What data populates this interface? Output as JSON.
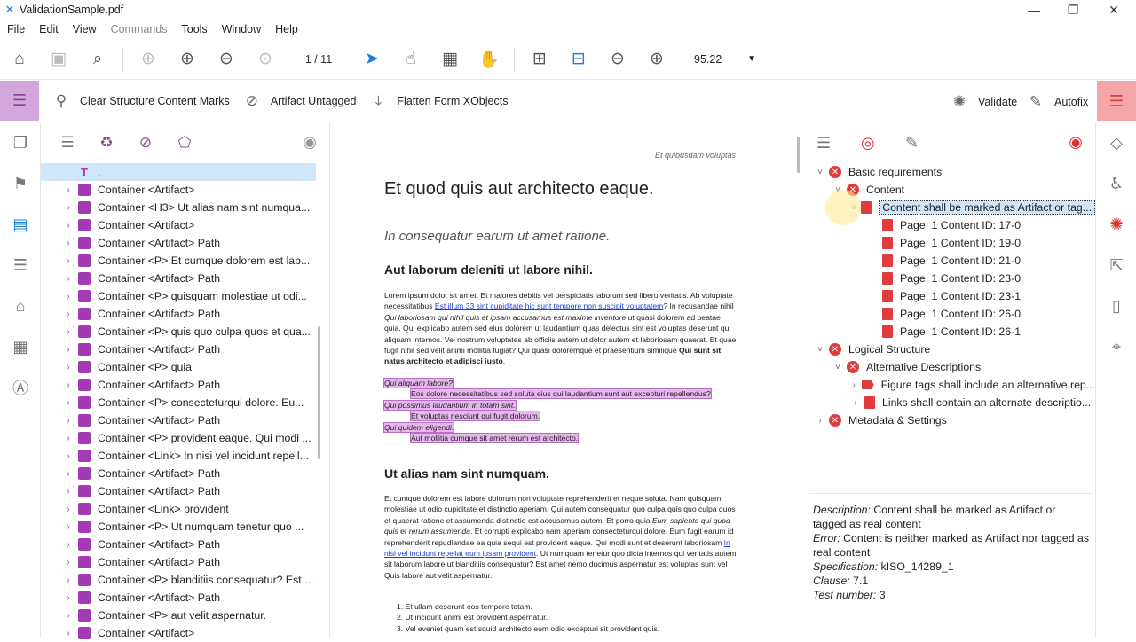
{
  "window": {
    "title": "ValidationSample.pdf",
    "controls": {
      "minimize": "—",
      "restore": "❐",
      "close": "✕"
    }
  },
  "menu": [
    "File",
    "Edit",
    "View",
    "Commands",
    "Tools",
    "Window",
    "Help"
  ],
  "toolbar": {
    "page_indicator": "1 / 11",
    "zoom_value": "95.22",
    "icons": [
      "home-icon",
      "save-icon",
      "search-icon",
      "up-icon",
      "down-icon",
      "back-icon",
      "forward-icon",
      "select-icon",
      "touch-icon",
      "grid-icon",
      "hand-icon",
      "fit-page-icon",
      "fit-width-icon",
      "zoom-out-icon",
      "zoom-in-icon"
    ]
  },
  "subtoolbar": {
    "clear_label": "Clear Structure Content Marks",
    "artifact_label": "Artifact Untagged",
    "flatten_label": "Flatten Form XObjects",
    "validate_label": "Validate",
    "autofix_label": "Autofix"
  },
  "structure_tree": [
    {
      "label": ".",
      "type": "text",
      "selected": true
    },
    {
      "label": "Container <Artifact>"
    },
    {
      "label": "Container <H3> Ut alias nam sint numqua..."
    },
    {
      "label": "Container <Artifact>"
    },
    {
      "label": "Container <Artifact> Path"
    },
    {
      "label": "Container <P> Et cumque dolorem est lab..."
    },
    {
      "label": "Container <Artifact> Path"
    },
    {
      "label": "Container <P> quisquam molestiae ut odi..."
    },
    {
      "label": "Container <Artifact> Path"
    },
    {
      "label": "Container <P> quis quo culpa quos et qua..."
    },
    {
      "label": "Container <Artifact> Path"
    },
    {
      "label": "Container <P> quia"
    },
    {
      "label": "Container <Artifact> Path"
    },
    {
      "label": "Container <P> consecteturqui dolore. Eu..."
    },
    {
      "label": "Container <Artifact> Path"
    },
    {
      "label": "Container <P> provident eaque. Qui modi ..."
    },
    {
      "label": "Container <Link> In nisi vel incidunt repell..."
    },
    {
      "label": "Container <Artifact> Path"
    },
    {
      "label": "Container <Artifact> Path"
    },
    {
      "label": "Container <Link> provident"
    },
    {
      "label": "Container <P> Ut numquam tenetur quo ..."
    },
    {
      "label": "Container <Artifact> Path"
    },
    {
      "label": "Container <Artifact> Path"
    },
    {
      "label": "Container <P> blanditiis consequatur? Est ..."
    },
    {
      "label": "Container <Artifact> Path"
    },
    {
      "label": "Container <P> aut velit aspernatur."
    },
    {
      "label": "Container <Artifact>"
    }
  ],
  "document": {
    "header": "Et quibusdam voluptas",
    "title": "Et quod quis aut architecto eaque.",
    "subtitle": "In consequatur earum ut amet ratione.",
    "heading1": "Aut laborum deleniti ut labore nihil.",
    "para1_a": "Lorem ipsum dolor sit amet. Et maiores debitis vel perspiciatis laborum sed libero veritatis. Ab voluptate necessitatibus ",
    "para1_link": "Est illum 33 sint cupiditate hic sunt tempore non suscipit voluptatem",
    "para1_b": "? In recusandae nihil ",
    "para1_i": "Qui laboriosam qui nihil quis et ipsam accusamus est maxime inventore",
    "para1_c": " ut quasi dolorem ad beatae quia. Qui explicabo autem sed eius dolorem ut laudantium quas delectus sint est voluptas deserunt qui aliquam internos. Vel nostrum voluptates ab officiis autem ut dolor autem et laboriosam quaerat. Et quae fugit nihil sed velit animi mollitia fugiat? Qui quasi doloremque et praesentium similique ",
    "para1_bold": "Qui sunt sit natus architecto et adipisci iusto",
    "para1_end": ".",
    "dl": [
      {
        "term": "Qui aliquam labore?",
        "def": "Eos dolore necessitatibus sed soluta eius qui laudantium sunt aut excepturi repellendus?"
      },
      {
        "term": "Qui possimus laudantium in totam sint.",
        "def": "Et voluptas nesciunt qui fugit dolorum."
      },
      {
        "term": "Qui quidem eligendi.",
        "def": "Aut mollitia cumque sit amet rerum est architecto."
      }
    ],
    "heading2": "Ut alias nam sint numquam.",
    "para2_a": "Et cumque dolorem est labore dolorum non voluptate reprehenderit et neque soluta. Nam quisquam molestiae ut odio cupiditate et distinctio aperiam. Qui autem consequatur quo culpa quis quo culpa quos et quaerat ratione et assumenda distinctio est accusamus autem. Et porro quia ",
    "para2_i": "Eum sapiente qui quod quis et rerum assumenda",
    "para2_b": ". Et corrupti explicabo nam aperiam consecteturqui dolore. Eum fugit earum id reprehenderit repudiandae ea quia sequi est provident eaque. Qui modi sunt et deserunt laboriosam ",
    "para2_link": "In nisi vel incidunt repellat eum ipsam provident",
    "para2_c": ". Ut numquam tenetur quo dicta internos qui veritatis autem sit laborum labore ut blanditiis consequatur? Est amet nemo ducimus aspernatur est voluptas sunt vel Quis labore aut velit aspernatur.",
    "list": [
      "Et ullam deserunt eos tempore totam.",
      "Ut incidunt animi est provident aspernatur.",
      "Vel eveniet quam est squid architecto eum odio excepturi sit provident quis."
    ]
  },
  "validation": {
    "tree": [
      {
        "label": "Basic requirements",
        "level": 0,
        "chev": "˅",
        "icon": "err"
      },
      {
        "label": "Content",
        "level": 1,
        "chev": "˅",
        "icon": "err"
      },
      {
        "label": "Content shall be marked as Artifact or tag...",
        "level": 2,
        "chev": "˅",
        "icon": "doc",
        "selected": true
      },
      {
        "label": "Page: 1 Content ID: 17-0",
        "level": 3,
        "icon": "doc"
      },
      {
        "label": "Page: 1 Content ID: 19-0",
        "level": 3,
        "icon": "doc"
      },
      {
        "label": "Page: 1 Content ID: 21-0",
        "level": 3,
        "icon": "doc"
      },
      {
        "label": "Page: 1 Content ID: 23-0",
        "level": 3,
        "icon": "doc"
      },
      {
        "label": "Page: 1 Content ID: 23-1",
        "level": 3,
        "icon": "doc"
      },
      {
        "label": "Page: 1 Content ID: 26-0",
        "level": 3,
        "icon": "doc"
      },
      {
        "label": "Page: 1 Content ID: 26-1",
        "level": 3,
        "icon": "doc"
      },
      {
        "label": "Logical Structure",
        "level": 0,
        "chev": "˅",
        "icon": "err"
      },
      {
        "label": "Alternative Descriptions",
        "level": 1,
        "chev": "˅",
        "icon": "err"
      },
      {
        "label": "Figure tags shall include an alternative rep...",
        "level": 2,
        "chev": "›",
        "icon": "flag"
      },
      {
        "label": "Links shall contain an alternate descriptio...",
        "level": 2,
        "chev": "›",
        "icon": "doc"
      },
      {
        "label": "Metadata & Settings",
        "level": 0,
        "chev": "›",
        "icon": "err"
      }
    ],
    "details": {
      "description_key": "Description:",
      "description_val": " Content shall be marked as Artifact or tagged as real content",
      "error_key": "Error:",
      "error_val": " Content is neither marked as Artifact nor tagged as real content",
      "spec_key": "Specification:",
      "spec_val": " kISO_14289_1",
      "clause_key": "Clause:",
      "clause_val": " 7.1",
      "test_key": "Test number:",
      "test_val": " 3"
    }
  },
  "colors": {
    "accent": "#1a7fd4",
    "tag": "#a23ab4",
    "error": "#e03c3c",
    "lilac": "#d3a6dd",
    "pink": "#f5a5a5"
  }
}
